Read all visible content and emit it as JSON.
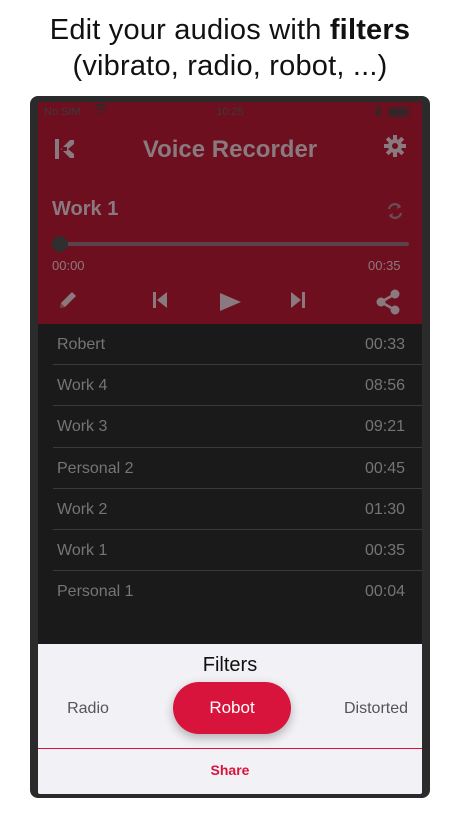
{
  "caption": {
    "line1_prefix": "Edit your audios with ",
    "line1_bold": "filters",
    "line2": "(vibrato, radio, robot, ...)"
  },
  "status_bar": {
    "carrier": "No SIM",
    "time": "10:25"
  },
  "navbar": {
    "title": "Voice Recorder",
    "logo_icon": "logo-k-icon",
    "settings_icon": "gear-icon"
  },
  "player": {
    "track_title": "Work 1",
    "elapsed": "00:00",
    "duration": "00:35",
    "progress_fraction": 0.0
  },
  "controls": [
    "edit-icon",
    "previous-icon",
    "play-icon",
    "next-icon",
    "share-icon"
  ],
  "recordings": [
    {
      "name": "Robert",
      "duration": "00:33"
    },
    {
      "name": "Work 4",
      "duration": "08:56"
    },
    {
      "name": "Work 3",
      "duration": "09:21"
    },
    {
      "name": "Personal 2",
      "duration": "00:45"
    },
    {
      "name": "Work 2",
      "duration": "01:30"
    },
    {
      "name": "Work 1",
      "duration": "00:35"
    },
    {
      "name": "Personal 1",
      "duration": "00:04"
    }
  ],
  "filters_sheet": {
    "title": "Filters",
    "left": "Radio",
    "selected": "Robot",
    "right": "Distorted",
    "share_label": "Share"
  },
  "colors": {
    "accent": "#d9143c",
    "player_bg": "#6e0f1f"
  }
}
